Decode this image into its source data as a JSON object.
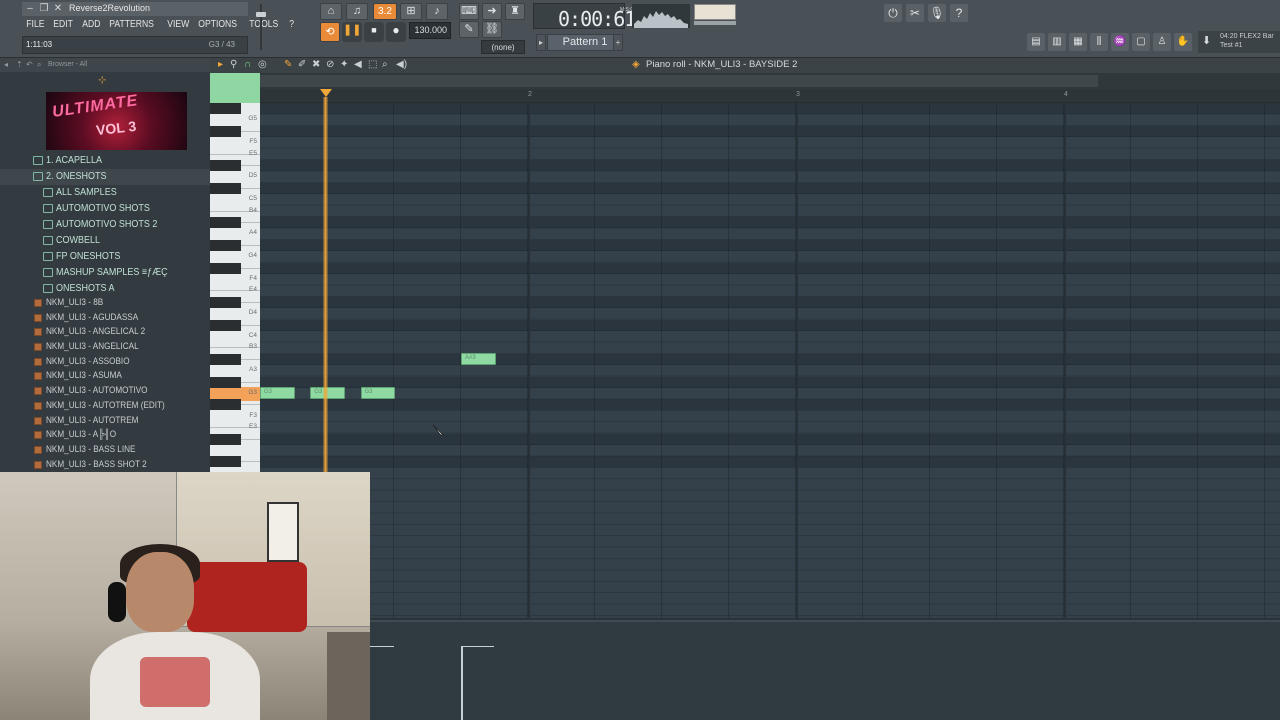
{
  "window": {
    "title": "Reverse2Revolution",
    "hint_left": "1:11:03",
    "hint_right": "G3 / 43"
  },
  "menu": [
    "FILE",
    "EDIT",
    "ADD",
    "PATTERNS",
    "VIEW",
    "OPTIONS",
    "TOOLS",
    "?"
  ],
  "transport": {
    "song_time": "0:00:61",
    "time_unit": "M:S:CS",
    "tempo": "130.000",
    "snap": "(none)",
    "pattern": "Pattern 1",
    "beat_label": "3.2"
  },
  "news": {
    "line1": "04:20  FLEX2 Bar",
    "line2": "Test #1"
  },
  "browser": {
    "title": "Browser - All",
    "folders": [
      {
        "label": "1. ACAPELLA",
        "indent": 0,
        "selected": false
      },
      {
        "label": "2. ONESHOTS",
        "indent": 0,
        "selected": true
      },
      {
        "label": "ALL SAMPLES",
        "indent": 1,
        "selected": false
      },
      {
        "label": "AUTOMOTIVO SHOTS",
        "indent": 1,
        "selected": false
      },
      {
        "label": "AUTOMOTIVO SHOTS 2",
        "indent": 1,
        "selected": false
      },
      {
        "label": "COWBELL",
        "indent": 1,
        "selected": false
      },
      {
        "label": "FP ONESHOTS",
        "indent": 1,
        "selected": false
      },
      {
        "label": "MASHUP SAMPLES ≡ƒÆÇ",
        "indent": 1,
        "selected": false
      },
      {
        "label": "ONESHOTS A",
        "indent": 1,
        "selected": false
      }
    ],
    "files": [
      "NKM_ULI3 - 8B",
      "NKM_ULI3 - AGUDASSA",
      "NKM_ULI3 - ANGELICAL 2",
      "NKM_ULI3 - ANGELICAL",
      "NKM_ULI3 - ASSOBIO",
      "NKM_ULI3 - ASUMA",
      "NKM_ULI3 - AUTOMOTIVO",
      "NKM_ULI3 - AUTOTREM (EDIT)",
      "NKM_ULI3 - AUTOTREM",
      "NKM_ULI3 - A╠╢O",
      "NKM_ULI3 - BASS LINE",
      "NKM_ULI3 - BASS SHOT 2"
    ]
  },
  "piano_roll": {
    "title": "Piano roll - NKM_ULI3 - BAYSIDE 2",
    "bars": [
      "2",
      "3",
      "4"
    ],
    "keys": [
      "G5",
      "F5",
      "E5",
      "D5",
      "C5",
      "B4",
      "A4",
      "G4",
      "F4",
      "E4",
      "D4",
      "C4",
      "B3",
      "A3",
      "G3",
      "F3",
      "E3"
    ],
    "highlighted_key": "G3",
    "notes": [
      {
        "label": "G3",
        "key": "G3",
        "start": 0.0,
        "length": 0.125
      },
      {
        "label": "G3",
        "key": "G3",
        "start": 0.1875,
        "length": 0.125
      },
      {
        "label": "G3",
        "key": "G3",
        "start": 0.375,
        "length": 0.125
      },
      {
        "label": "A#3",
        "key": "A#3",
        "start": 0.75,
        "length": 0.125
      }
    ]
  },
  "colors": {
    "accent_orange": "#f1a638",
    "note_green": "#8fd9a3",
    "grid_bg": "#34414a"
  }
}
